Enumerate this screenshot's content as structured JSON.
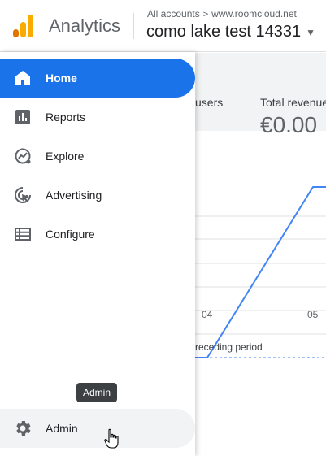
{
  "header": {
    "app_name": "Analytics",
    "breadcrumb_all": "All accounts",
    "breadcrumb_separator": ">",
    "breadcrumb_account": "www.roomcloud.net",
    "property_name": "como lake test 14331",
    "property_caret_icon": "caret-down-icon"
  },
  "nav": {
    "items": [
      {
        "label": "Home",
        "icon": "home-icon",
        "active": true
      },
      {
        "label": "Reports",
        "icon": "bar-chart-icon",
        "active": false
      },
      {
        "label": "Explore",
        "icon": "explore-icon",
        "active": false
      },
      {
        "label": "Advertising",
        "icon": "advertising-icon",
        "active": false
      },
      {
        "label": "Configure",
        "icon": "configure-icon",
        "active": false
      }
    ],
    "admin": {
      "label": "Admin",
      "icon": "gear-icon",
      "tooltip": "Admin"
    }
  },
  "background": {
    "metric_users_label": "users",
    "metric_revenue_label": "Total revenue",
    "metric_revenue_value": "€0.00",
    "legend_text": "receding period"
  },
  "colors": {
    "accent": "#1a73e8",
    "logo_orange": "#f9ab00",
    "logo_dark_orange": "#e37400",
    "chart_line": "#4285f4"
  },
  "chart_data": {
    "type": "line",
    "x": [
      "04",
      "05"
    ],
    "series": [
      {
        "values": [
          0,
          1
        ]
      }
    ]
  }
}
